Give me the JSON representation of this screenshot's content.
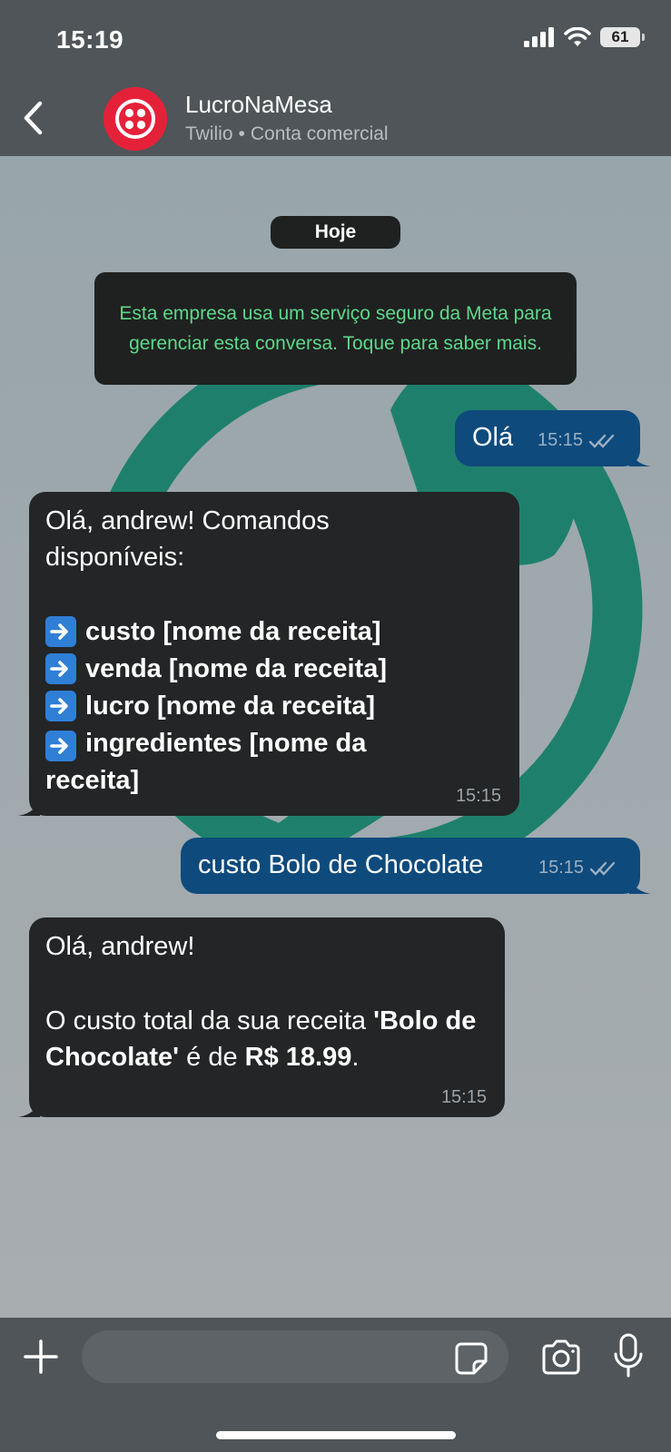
{
  "status_bar": {
    "time": "15:19",
    "battery": "61"
  },
  "header": {
    "contact_name": "LucroNaMesa",
    "provider": "Twilio",
    "account_type": "Conta comercial"
  },
  "chat": {
    "date_label": "Hoje",
    "notice": "Esta empresa usa um serviço seguro da Meta para gerenciar esta conversa. Toque para saber mais.",
    "messages": [
      {
        "text": "Olá",
        "time": "15:15"
      },
      {
        "intro": "Olá, andrew! Comandos disponíveis:",
        "commands": [
          "custo [nome da receita]",
          "venda [nome da receita]",
          "lucro [nome da receita]",
          "ingredientes [nome da receita]"
        ],
        "time": "15:15"
      },
      {
        "text": "custo Bolo de Chocolate",
        "time": "15:15"
      },
      {
        "greeting": "Olá, andrew!",
        "body_prefix": "O custo total da sua receita ",
        "recipe": "'Bolo de Chocolate'",
        "body_middle": " é de ",
        "amount": "R$ 18.99",
        "body_suffix": ".",
        "time": "15:15"
      }
    ]
  },
  "icons": {
    "back": "chevron-left-icon",
    "avatar": "twilio-logo",
    "read_receipt": "double-check-icon",
    "attach": "plus-icon",
    "sticker": "sticker-icon",
    "camera": "camera-icon",
    "mic": "microphone-icon"
  },
  "colors": {
    "header_bg": "#4f5558",
    "outgoing_bubble": "#0e4a7c",
    "incoming_bubble": "#232526",
    "notice_text": "#5ed889",
    "avatar_bg": "#e5213a"
  }
}
